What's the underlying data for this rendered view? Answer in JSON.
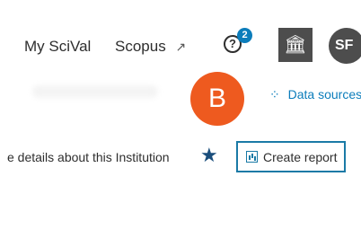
{
  "header": {
    "nav": [
      {
        "label": "My SciVal"
      },
      {
        "label": "Scopus",
        "external_icon": "external-link-icon",
        "glyph": "↗"
      }
    ],
    "help": {
      "icon": "help-icon",
      "glyph": "?",
      "badge": "2"
    },
    "institution": {
      "icon": "institution-icon",
      "glyph": "🏛"
    },
    "user": {
      "initials": "SF"
    }
  },
  "marker": {
    "label": "B",
    "color": "#ee5a1f"
  },
  "data_sources": {
    "icon": "spinner-icon",
    "glyph": "⁘",
    "label": "Data sources"
  },
  "content": {
    "details_text": "e details about this Institution",
    "star_glyph": "★",
    "create_report": {
      "label": "Create report",
      "icon": "report-icon"
    }
  },
  "colors": {
    "accent": "#0c7dbb",
    "dark": "#4d4d4d",
    "marker": "#ee5a1f"
  }
}
